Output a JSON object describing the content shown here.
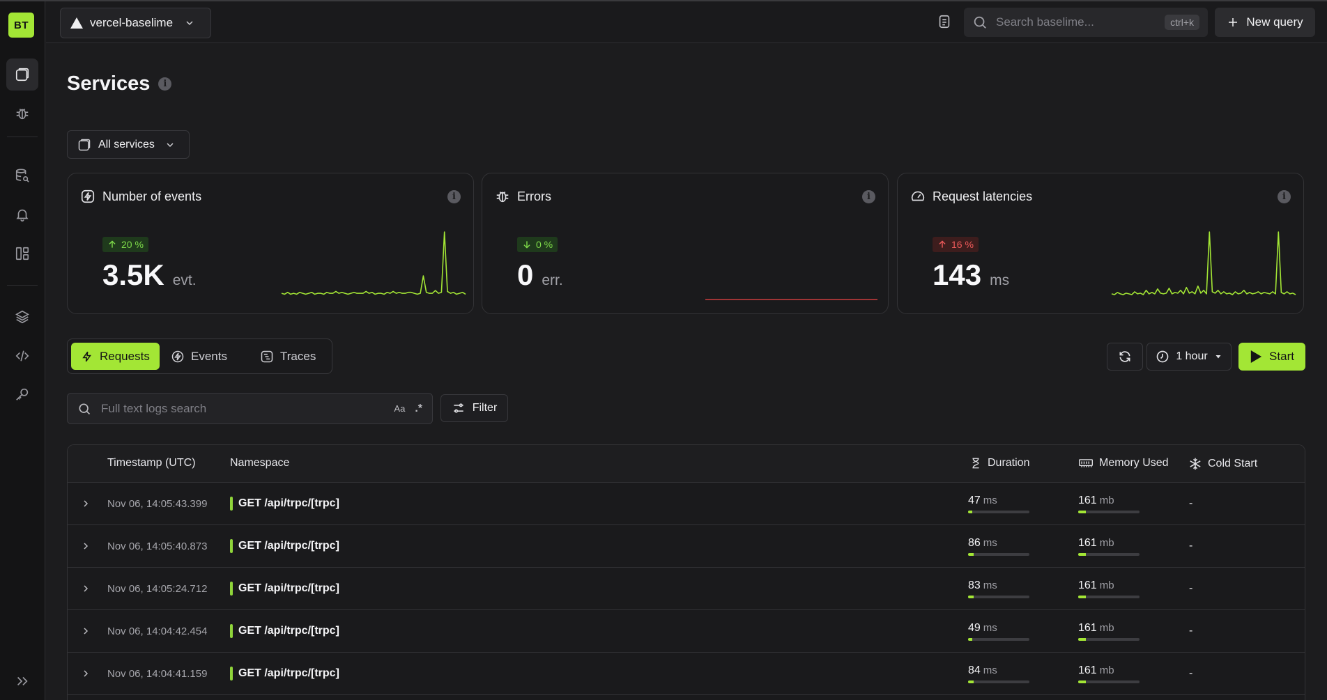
{
  "sidebar": {
    "logo": "BT"
  },
  "header": {
    "workspace": "vercel-baselime",
    "search_placeholder": "Search baselime...",
    "shortcut": "ctrl+k",
    "new_query_label": "New query"
  },
  "page": {
    "title": "Services",
    "services_filter": "All services"
  },
  "cards": [
    {
      "title": "Number of events",
      "change": "20 %",
      "direction": "up",
      "value": "3.5K",
      "unit": "evt.",
      "color": "#a3e635",
      "spark": [
        3,
        2,
        4,
        2,
        3,
        2,
        4,
        3,
        2,
        3,
        4,
        2,
        3,
        3,
        2,
        4,
        3,
        3,
        5,
        3,
        4,
        3,
        2,
        3,
        4,
        3,
        3,
        3,
        5,
        3,
        4,
        2,
        3,
        3,
        2,
        4,
        3,
        5,
        3,
        4,
        3,
        3,
        4,
        4,
        3,
        2,
        3,
        22,
        4,
        3,
        3,
        6,
        3,
        4,
        70,
        5,
        3,
        4,
        2,
        3,
        4,
        2
      ]
    },
    {
      "title": "Errors",
      "change": "0 %",
      "direction": "down",
      "value": "0",
      "unit": "err.",
      "color": "#ef4444",
      "spark": []
    },
    {
      "title": "Request latencies",
      "change": "16 %",
      "direction": "up",
      "value": "143",
      "unit": "ms",
      "color": "#a3e635",
      "spark": [
        3,
        2,
        5,
        3,
        2,
        4,
        3,
        2,
        6,
        3,
        4,
        2,
        8,
        3,
        5,
        3,
        10,
        4,
        3,
        4,
        11,
        3,
        5,
        4,
        8,
        3,
        12,
        4,
        6,
        3,
        14,
        4,
        8,
        3,
        90,
        6,
        4,
        8,
        3,
        6,
        3,
        4,
        2,
        6,
        3,
        4,
        8,
        3,
        5,
        3,
        4,
        6,
        3,
        5,
        4,
        3,
        6,
        3,
        90,
        5,
        3,
        6,
        3,
        4,
        2
      ]
    }
  ],
  "tabs": [
    {
      "label": "Requests",
      "icon": "bolt-icon"
    },
    {
      "label": "Events",
      "icon": "event-icon"
    },
    {
      "label": "Traces",
      "icon": "traces-icon"
    }
  ],
  "controls": {
    "time_range": "1 hour",
    "start_label": "Start",
    "filter_label": "Filter",
    "log_search_placeholder": "Full text logs search",
    "case_toggle": "Aa",
    "regex_toggle": ".*"
  },
  "table": {
    "columns": [
      "Timestamp (UTC)",
      "Namespace",
      "Duration",
      "Memory Used",
      "Cold Start"
    ],
    "rows": [
      {
        "timestamp": "Nov 06, 14:05:43.399",
        "namespace": "GET /api/trpc/[trpc]",
        "duration": "47",
        "duration_unit": "ms",
        "duration_pct": 0.07,
        "memory": "161",
        "memory_unit": "mb",
        "memory_pct": 0.13,
        "cold_start": "-"
      },
      {
        "timestamp": "Nov 06, 14:05:40.873",
        "namespace": "GET /api/trpc/[trpc]",
        "duration": "86",
        "duration_unit": "ms",
        "duration_pct": 0.09,
        "memory": "161",
        "memory_unit": "mb",
        "memory_pct": 0.13,
        "cold_start": "-"
      },
      {
        "timestamp": "Nov 06, 14:05:24.712",
        "namespace": "GET /api/trpc/[trpc]",
        "duration": "83",
        "duration_unit": "ms",
        "duration_pct": 0.09,
        "memory": "161",
        "memory_unit": "mb",
        "memory_pct": 0.13,
        "cold_start": "-"
      },
      {
        "timestamp": "Nov 06, 14:04:42.454",
        "namespace": "GET /api/trpc/[trpc]",
        "duration": "49",
        "duration_unit": "ms",
        "duration_pct": 0.07,
        "memory": "161",
        "memory_unit": "mb",
        "memory_pct": 0.13,
        "cold_start": "-"
      },
      {
        "timestamp": "Nov 06, 14:04:41.159",
        "namespace": "GET /api/trpc/[trpc]",
        "duration": "84",
        "duration_unit": "ms",
        "duration_pct": 0.09,
        "memory": "161",
        "memory_unit": "mb",
        "memory_pct": 0.13,
        "cold_start": "-"
      }
    ]
  }
}
